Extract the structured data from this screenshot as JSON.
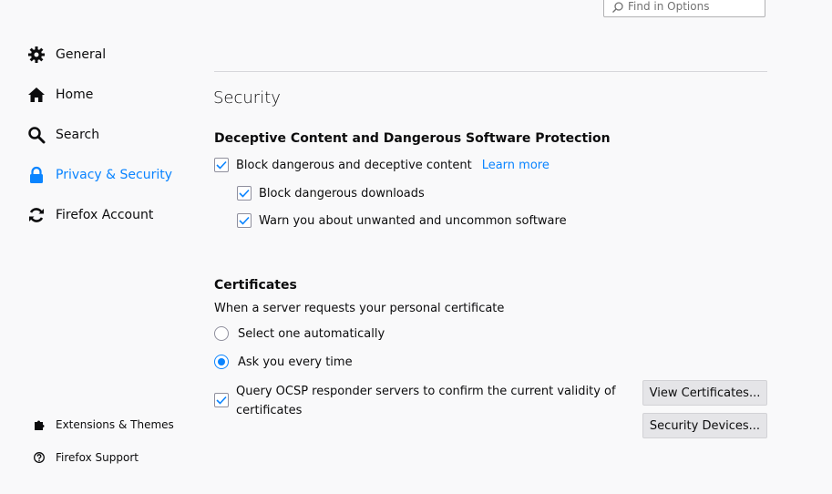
{
  "search": {
    "placeholder": "Find in Options"
  },
  "sidebar": {
    "items": [
      {
        "label": "General",
        "icon": "gear-icon"
      },
      {
        "label": "Home",
        "icon": "home-icon"
      },
      {
        "label": "Search",
        "icon": "search-icon"
      },
      {
        "label": "Privacy & Security",
        "icon": "lock-icon",
        "selected": true
      },
      {
        "label": "Firefox Account",
        "icon": "sync-icon"
      }
    ],
    "footer": [
      {
        "label": "Extensions & Themes",
        "icon": "puzzle-icon"
      },
      {
        "label": "Firefox Support",
        "icon": "help-icon"
      }
    ]
  },
  "main": {
    "section_title": "Security",
    "deceptive": {
      "heading": "Deceptive Content and Dangerous Software Protection",
      "block_deceptive": {
        "label": "Block dangerous and deceptive content",
        "checked": true
      },
      "learn_more": "Learn more",
      "block_downloads": {
        "label": "Block dangerous downloads",
        "checked": true
      },
      "warn_unwanted": {
        "label": "Warn you about unwanted and uncommon software",
        "checked": true
      }
    },
    "certificates": {
      "heading": "Certificates",
      "description": "When a server requests your personal certificate",
      "select_auto": {
        "label": "Select one automatically",
        "checked": false
      },
      "ask_every_time": {
        "label": "Ask you every time",
        "checked": true
      },
      "ocsp": {
        "label": "Query OCSP responder servers to confirm the current validity of certificates",
        "checked": true
      },
      "view_certificates_button": "View Certificates...",
      "security_devices_button": "Security Devices..."
    }
  },
  "colors": {
    "accent": "#0a84ff",
    "background": "#f9f9fa",
    "text": "#0c0c0d"
  }
}
